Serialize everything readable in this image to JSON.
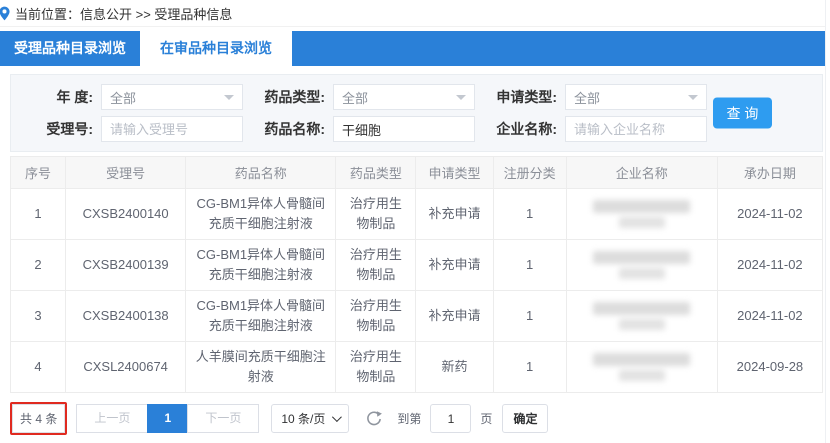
{
  "breadcrumb": {
    "label": "当前位置：信息公开 >> 受理品种信息"
  },
  "tabs": [
    {
      "label": "受理品种目录浏览",
      "active": false
    },
    {
      "label": "在审品种目录浏览",
      "active": true
    }
  ],
  "search": {
    "year_label": "年 度:",
    "year_value": "全部",
    "drug_type_label": "药品类型:",
    "drug_type_value": "全部",
    "apply_type_label": "申请类型:",
    "apply_type_value": "全部",
    "acceptance_no_label": "受理号:",
    "acceptance_no_placeholder": "请输入受理号",
    "drug_name_label": "药品名称:",
    "drug_name_value": "干细胞",
    "company_label": "企业名称:",
    "company_placeholder": "请输入企业名称",
    "query_button": "查 询"
  },
  "table": {
    "headers": [
      "序号",
      "受理号",
      "药品名称",
      "药品类型",
      "申请类型",
      "注册分类",
      "企业名称",
      "承办日期"
    ],
    "rows": [
      {
        "seq": "1",
        "acceptance_no": "CXSB2400140",
        "drug_name": "CG-BM1异体人骨髓间充质干细胞注射液",
        "drug_type": "治疗用生物制品",
        "apply_type": "补充申请",
        "reg_class": "1",
        "company_redacted": true,
        "date": "2024-11-02"
      },
      {
        "seq": "2",
        "acceptance_no": "CXSB2400139",
        "drug_name": "CG-BM1异体人骨髓间充质干细胞注射液",
        "drug_type": "治疗用生物制品",
        "apply_type": "补充申请",
        "reg_class": "1",
        "company_redacted": true,
        "date": "2024-11-02"
      },
      {
        "seq": "3",
        "acceptance_no": "CXSB2400138",
        "drug_name": "CG-BM1异体人骨髓间充质干细胞注射液",
        "drug_type": "治疗用生物制品",
        "apply_type": "补充申请",
        "reg_class": "1",
        "company_redacted": true,
        "date": "2024-11-02"
      },
      {
        "seq": "4",
        "acceptance_no": "CXSL2400674",
        "drug_name": "人羊膜间充质干细胞注射液",
        "drug_type": "治疗用生物制品",
        "apply_type": "新药",
        "reg_class": "1",
        "company_redacted": true,
        "date": "2024-09-28"
      }
    ]
  },
  "pagination": {
    "total_label": "共 4 条",
    "prev_label": "上一页",
    "current_page": "1",
    "next_label": "下一页",
    "page_size_label": "10 条/页",
    "goto_label": "到第",
    "goto_value": "1",
    "page_unit_label": "页",
    "confirm_label": "确定"
  },
  "icons": {
    "location_pin": "map-pin",
    "select_caret": "chevron-down",
    "page_size_caret": "chevron-down",
    "refresh": "circular-refresh-arrow"
  },
  "colors": {
    "tab_blue": "#2a80d8",
    "query_button_blue": "#2e9cf0",
    "active_page_blue": "#2a80d8",
    "annotation_red": "#e02a20",
    "panel_bg": "#f5f7fa",
    "header_bg": "#f7f7f7"
  }
}
